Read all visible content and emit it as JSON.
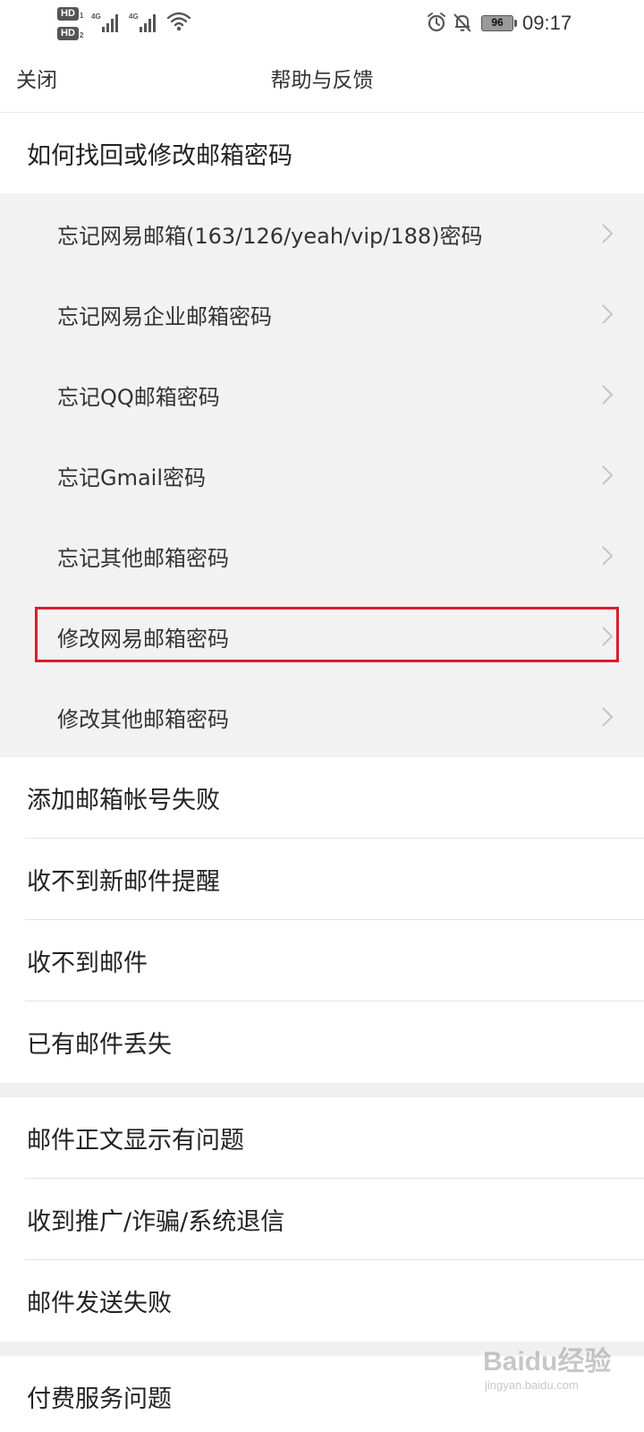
{
  "status_bar": {
    "sim1_label": "HD",
    "sim1_index": "1",
    "sim2_label": "HD",
    "sim2_index": "2",
    "network1": "4G",
    "network2": "4G",
    "battery_level": "96",
    "time": "09:17",
    "icons": [
      "signal-icon",
      "wifi-icon",
      "alarm-icon",
      "bell-off-icon",
      "battery-icon"
    ]
  },
  "nav": {
    "close_label": "关闭",
    "title": "帮助与反馈"
  },
  "sections": {
    "password_header": "如何找回或修改邮箱密码",
    "password_items": [
      "忘记网易邮箱(163/126/yeah/vip/188)密码",
      "忘记网易企业邮箱密码",
      "忘记QQ邮箱密码",
      "忘记Gmail密码",
      "忘记其他邮箱密码",
      "修改网易邮箱密码",
      "修改其他邮箱密码"
    ],
    "group1": [
      "添加邮箱帐号失败",
      "收不到新邮件提醒",
      "收不到邮件",
      "已有邮件丢失"
    ],
    "group2": [
      "邮件正文显示有问题",
      "收到推广/诈骗/系统退信",
      "邮件发送失败"
    ],
    "group3": [
      "付费服务问题"
    ]
  },
  "watermark": {
    "brand": "Baidu经验",
    "url": "jingyan.baidu.com"
  },
  "colors": {
    "highlight": "#d61f2c",
    "sub_background": "#f2f2f2",
    "band": "#f0f0f0"
  }
}
